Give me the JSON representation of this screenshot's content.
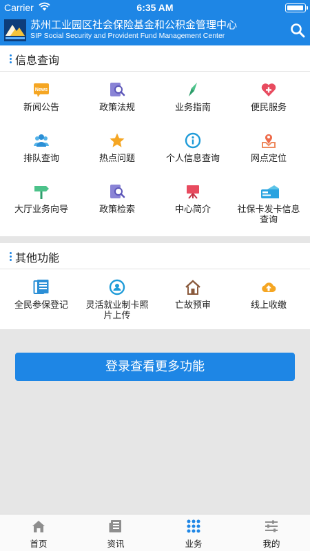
{
  "status": {
    "carrier": "Carrier",
    "time": "6:35 AM"
  },
  "app": {
    "title_cn": "苏州工业园区社会保险基金和公积金管理中心",
    "title_en": "SIP Social Security and Provident Fund Management Center"
  },
  "colors": {
    "primary": "#1e86e5",
    "header_bg": "#1e86e5"
  },
  "sections": {
    "info": {
      "title": "信息查询",
      "items": [
        {
          "label": "新闻公告",
          "icon": "news-icon"
        },
        {
          "label": "政策法规",
          "icon": "policy-search-icon"
        },
        {
          "label": "业务指南",
          "icon": "compass-icon"
        },
        {
          "label": "便民服务",
          "icon": "heart-plus-icon"
        },
        {
          "label": "排队查询",
          "icon": "people-icon"
        },
        {
          "label": "热点问题",
          "icon": "star-icon"
        },
        {
          "label": "个人信息查询",
          "icon": "info-icon"
        },
        {
          "label": "网点定位",
          "icon": "location-pin-icon"
        },
        {
          "label": "大厅业务向导",
          "icon": "signpost-icon"
        },
        {
          "label": "政策检索",
          "icon": "policy-search-icon"
        },
        {
          "label": "中心简介",
          "icon": "easel-icon"
        },
        {
          "label": "社保卡发卡信息查询",
          "icon": "card-icon"
        }
      ]
    },
    "other": {
      "title": "其他功能",
      "items": [
        {
          "label": "全民参保登记",
          "icon": "register-doc-icon"
        },
        {
          "label": "灵活就业制卡照片上传",
          "icon": "person-circle-icon"
        },
        {
          "label": "亡故预审",
          "icon": "house-icon"
        },
        {
          "label": "线上收缴",
          "icon": "cloud-upload-icon"
        }
      ]
    }
  },
  "login_button": "登录查看更多功能",
  "tabbar": [
    {
      "label": "首页",
      "icon": "home-icon"
    },
    {
      "label": "资讯",
      "icon": "newspaper-icon"
    },
    {
      "label": "业务",
      "icon": "grid-dots-icon"
    },
    {
      "label": "我的",
      "icon": "sliders-icon"
    }
  ]
}
